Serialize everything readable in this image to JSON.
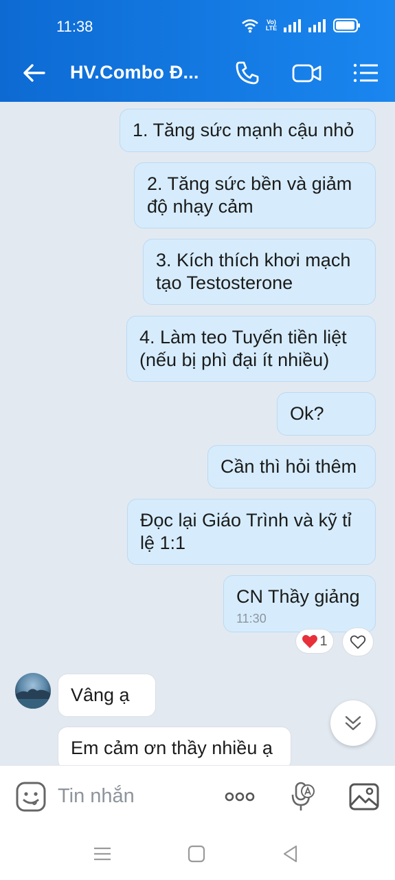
{
  "status": {
    "time": "11:38",
    "volte_label": "Vo) LTE"
  },
  "header": {
    "title": "HV.Combo Đ..."
  },
  "messages": [
    {
      "text": "1. Tăng sức mạnh cậu nhỏ",
      "direction": "out"
    },
    {
      "text": "2. Tăng sức bền và giảm độ nhạy cảm",
      "direction": "out"
    },
    {
      "text": "3. Kích thích khơi mạch tạo Testosterone",
      "direction": "out"
    },
    {
      "text": "4. Làm teo Tuyến tiền liệt (nếu bị phì đại ít nhiều)",
      "direction": "out"
    },
    {
      "text": "Ok?",
      "direction": "out"
    },
    {
      "text": "Cần thì hỏi thêm",
      "direction": "out"
    },
    {
      "text": "Đọc lại Giáo Trình và kỹ tỉ lệ 1:1",
      "direction": "out"
    },
    {
      "text": "CN Thầy giảng",
      "direction": "out",
      "time": "11:30"
    },
    {
      "text": "Vâng ạ",
      "direction": "in"
    },
    {
      "text": "Em cảm ơn thầy nhiều ạ",
      "direction": "in"
    }
  ],
  "reaction": {
    "emoji": "heart-icon",
    "count": "1"
  },
  "composer": {
    "placeholder": "Tin nhắn"
  },
  "colors": {
    "header": "#1a86ef",
    "out_bubble": "#d6ecfc",
    "in_bubble": "#ffffff",
    "background": "#e2e9f1"
  }
}
